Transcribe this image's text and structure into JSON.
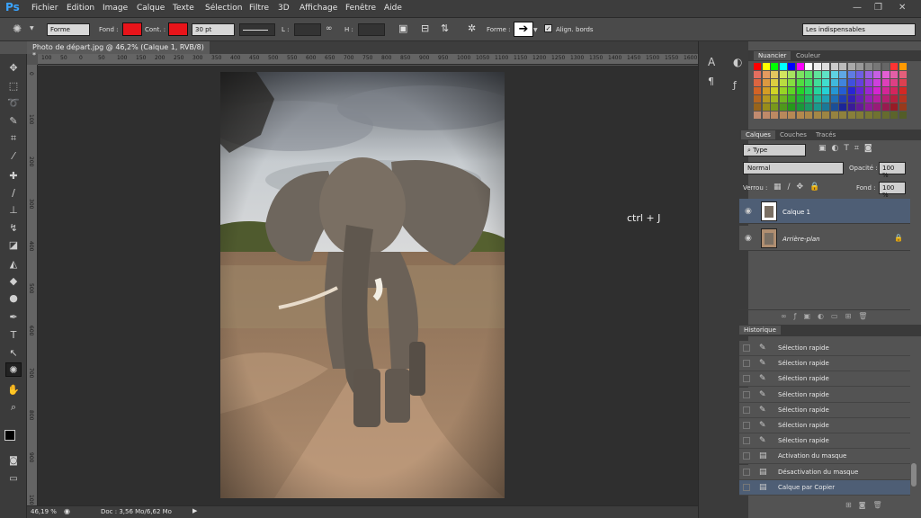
{
  "menubar": {
    "logo": "Ps",
    "items": [
      "Fichier",
      "Edition",
      "Image",
      "Calque",
      "Texte",
      "Sélection",
      "Filtre",
      "3D",
      "Affichage",
      "Fenêtre",
      "Aide"
    ]
  },
  "options": {
    "tool_mode": "Forme",
    "fill_label": "Fond :",
    "stroke_label": "Cont. :",
    "stroke_size": "30 pt",
    "width_label": "L :",
    "height_label": "H :",
    "shape_label": "Forme :",
    "align_label": "Align. bords",
    "workspace": "Les indispensables",
    "fill_color": "#e8141a",
    "stroke_color": "#e8141a"
  },
  "document": {
    "tab_title": "Photo de départ.jpg @ 46,2% (Calque 1, RVB/8) *",
    "ruler_h": [
      "100",
      "50",
      "0",
      "50",
      "100",
      "150",
      "200",
      "250",
      "300",
      "350",
      "400",
      "450",
      "500",
      "550",
      "600",
      "650",
      "700",
      "750",
      "800",
      "850",
      "900",
      "950",
      "1000",
      "1050",
      "1100",
      "1150",
      "1200",
      "1250",
      "1300",
      "1350",
      "1400",
      "1450",
      "1500",
      "1550",
      "1600"
    ],
    "ruler_v": [
      "0",
      "100",
      "200",
      "300",
      "400",
      "500",
      "600",
      "700",
      "800",
      "900",
      "1000"
    ],
    "annotation": "ctrl + J"
  },
  "status": {
    "zoom": "46,19 %",
    "doc_info": "Doc : 3,56 Mo/6,62 Mo"
  },
  "swatches": {
    "tabs": [
      "Nuancier",
      "Couleur"
    ]
  },
  "layers": {
    "tabs": [
      "Calques",
      "Couches",
      "Tracés"
    ],
    "filter": "Type",
    "blend_mode": "Normal",
    "opacity_label": "Opacité :",
    "opacity": "100 %",
    "lock_label": "Verrou :",
    "fill_label": "Fond :",
    "fill": "100 %",
    "items": [
      {
        "name": "Calque 1",
        "selected": true
      },
      {
        "name": "Arrière-plan",
        "selected": false
      }
    ]
  },
  "history": {
    "title": "Historique",
    "items": [
      {
        "label": "Sélection rapide",
        "selected": false
      },
      {
        "label": "Sélection rapide",
        "selected": false
      },
      {
        "label": "Sélection rapide",
        "selected": false
      },
      {
        "label": "Sélection rapide",
        "selected": false
      },
      {
        "label": "Sélection rapide",
        "selected": false
      },
      {
        "label": "Sélection rapide",
        "selected": false
      },
      {
        "label": "Sélection rapide",
        "selected": false
      },
      {
        "label": "Activation du masque",
        "selected": false
      },
      {
        "label": "Désactivation du masque",
        "selected": false
      },
      {
        "label": "Calque par Copier",
        "selected": true
      }
    ]
  },
  "colors": {
    "foreground": "#000000",
    "background": "#c0141c",
    "selection": "#4e5e75"
  }
}
